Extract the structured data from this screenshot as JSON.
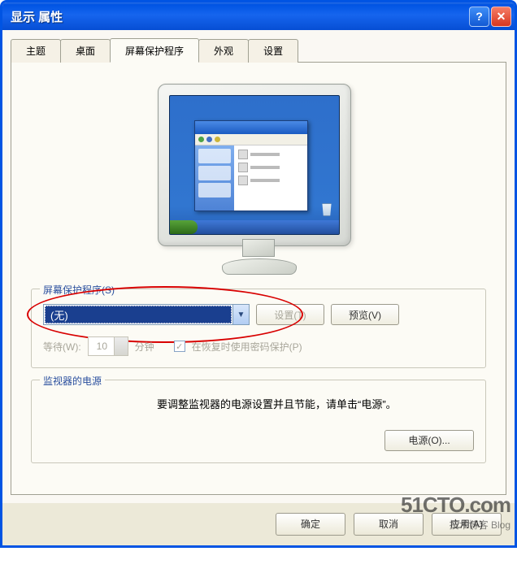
{
  "window": {
    "title": "显示 属性"
  },
  "tabs": {
    "theme": "主题",
    "desktop": "桌面",
    "screensaver": "屏幕保护程序",
    "appearance": "外观",
    "settings": "设置"
  },
  "screensaver_group": {
    "title": "屏幕保护程序(S)",
    "selection": "(无)",
    "settings_btn": "设置(T)",
    "preview_btn": "预览(V)",
    "wait_label": "等待(W):",
    "wait_value": "10",
    "wait_unit": "分钟",
    "resume_checkbox": "在恢复时使用密码保护(P)"
  },
  "monitor_group": {
    "title": "监视器的电源",
    "description": "要调整监视器的电源设置并且节能，请单击“电源”。",
    "power_btn": "电源(O)..."
  },
  "dialog_buttons": {
    "ok": "确定",
    "cancel": "取消",
    "apply": "应用(A)"
  },
  "watermark": {
    "main": "51CTO.com",
    "sub": "技术博客 Blog"
  }
}
